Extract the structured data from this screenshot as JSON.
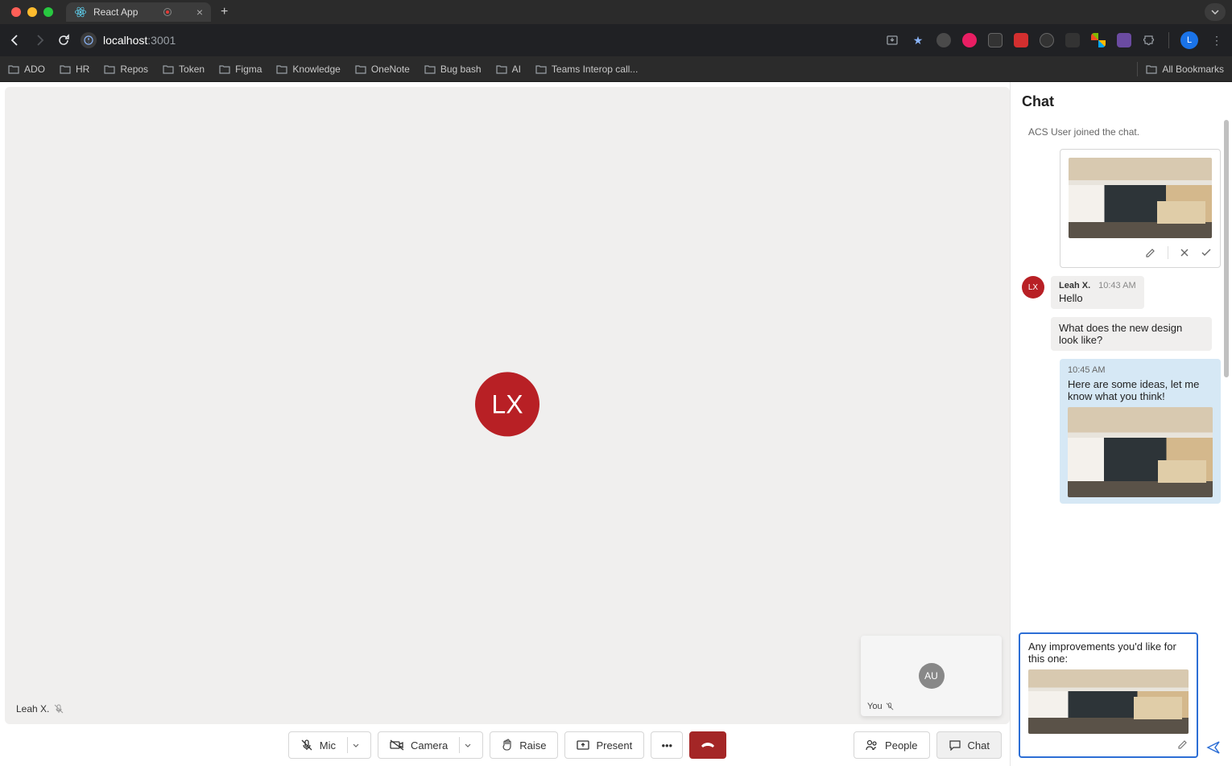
{
  "browser": {
    "tab_title": "React App",
    "url_host": "localhost",
    "url_path": ":3001",
    "bookmarks": [
      "ADO",
      "HR",
      "Repos",
      "Token",
      "Figma",
      "Knowledge",
      "OneNote",
      "Bug bash",
      "AI",
      "Teams Interop call..."
    ],
    "all_bookmarks": "All Bookmarks",
    "profile_initial": "L"
  },
  "video": {
    "main_initials": "LX",
    "main_name": "Leah X.",
    "self_initials": "AU",
    "self_label": "You"
  },
  "controls": {
    "mic": "Mic",
    "camera": "Camera",
    "raise": "Raise",
    "present": "Present",
    "people": "People",
    "chat": "Chat"
  },
  "chat": {
    "title": "Chat",
    "system": "ACS User joined the chat.",
    "incoming": {
      "author": "Leah X.",
      "avatar": "LX",
      "time": "10:43 AM",
      "msg1": "Hello",
      "msg2": "What does the new design look like?"
    },
    "outgoing": {
      "time": "10:45 AM",
      "msg": "Here are some ideas, let me know what you think!"
    },
    "compose": "Any improvements you'd like for this one:"
  }
}
